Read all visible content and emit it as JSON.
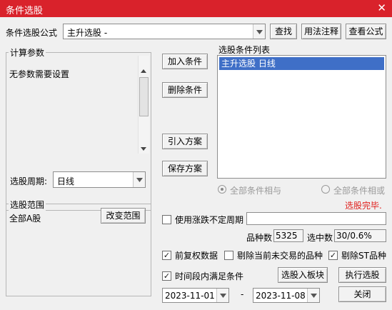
{
  "window": {
    "title": "条件选股",
    "close_glyph": "✕"
  },
  "formula": {
    "label": "条件选股公式",
    "value": "主升选股      -",
    "buttons": [
      "查找",
      "用法注释",
      "查看公式"
    ]
  },
  "params": {
    "group_title": "计算参数",
    "text": "无参数需要设置",
    "period_label": "选股周期:",
    "period_value": "日线"
  },
  "actions": {
    "add": "加入条件",
    "remove": "删除条件",
    "import": "引入方案",
    "save": "保存方案"
  },
  "conditions": {
    "title": "选股条件列表",
    "items": [
      "主升选股  日线"
    ]
  },
  "logic": {
    "and_label": "全部条件相与",
    "or_label": "全部条件相或",
    "selected": "and"
  },
  "status": {
    "text": "选股完毕.",
    "color": "#e0201d"
  },
  "scope": {
    "group_title": "选股范围",
    "value": "全部A股",
    "change_button": "改变范围"
  },
  "period_option": {
    "label": "使用涨跌不定周期",
    "checked": false,
    "value": ""
  },
  "counts": {
    "total_label": "品种数",
    "total_value": "5325",
    "selected_label": "选中数",
    "selected_value": "30/0.6%"
  },
  "options": {
    "adjusted": {
      "label": "前复权数据",
      "checked": true
    },
    "exclude_untraded": {
      "label": "剔除当前未交易的品种",
      "checked": false
    },
    "exclude_st": {
      "label": "剔除ST品种",
      "checked": true
    },
    "time_range": {
      "label": "时间段内满足条件",
      "checked": true
    }
  },
  "dates": {
    "start": "2023-11-01",
    "separator": "-",
    "end": "2023-11-08"
  },
  "bottom_buttons": {
    "to_block": "选股入板块",
    "execute": "执行选股",
    "close": "关闭"
  },
  "colors": {
    "title_bar": "#d9222b",
    "selection": "#3f6fc7",
    "check_mark": "#1a1a1a"
  }
}
